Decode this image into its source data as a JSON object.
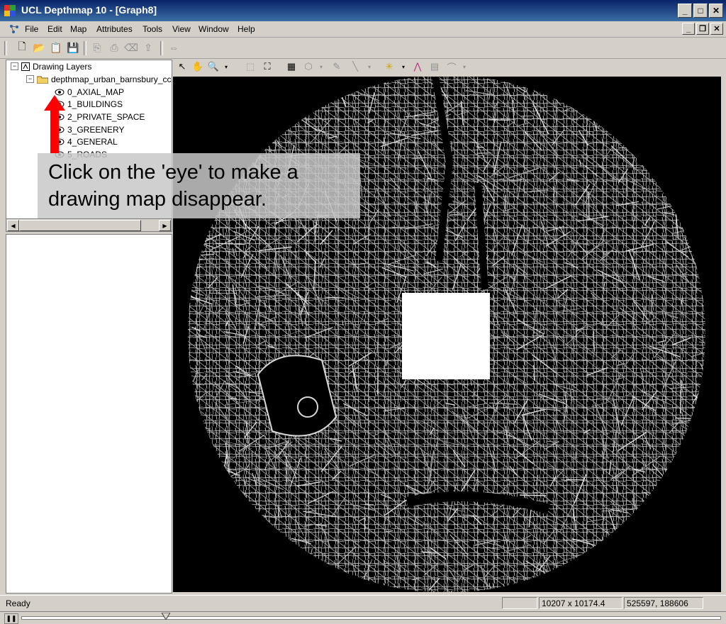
{
  "window": {
    "title": "UCL Depthmap 10 - [Graph8]"
  },
  "menu": {
    "items": [
      "File",
      "Edit",
      "Map",
      "Attributes",
      "Tools",
      "View",
      "Window",
      "Help"
    ]
  },
  "tree": {
    "root_label": "Drawing Layers",
    "folder_label": "depthmap_urban_barnsbury_cc",
    "layers": [
      "0_AXIAL_MAP",
      "1_BUILDINGS",
      "2_PRIVATE_SPACE",
      "3_GREENERY",
      "4_GENERAL",
      "5_ROADS"
    ]
  },
  "callout": {
    "line1": "Click on the 'eye' to make a",
    "line2": "drawing map disappear."
  },
  "status": {
    "text": "Ready",
    "dimensions": "10207 x 10174.4",
    "coords": "525597, 188606"
  },
  "colors": {
    "title_start": "#0a246a",
    "title_end": "#3a6ea5",
    "arrow": "#ff0000",
    "map_bg": "#000000",
    "streets": "#d8d8d8"
  }
}
